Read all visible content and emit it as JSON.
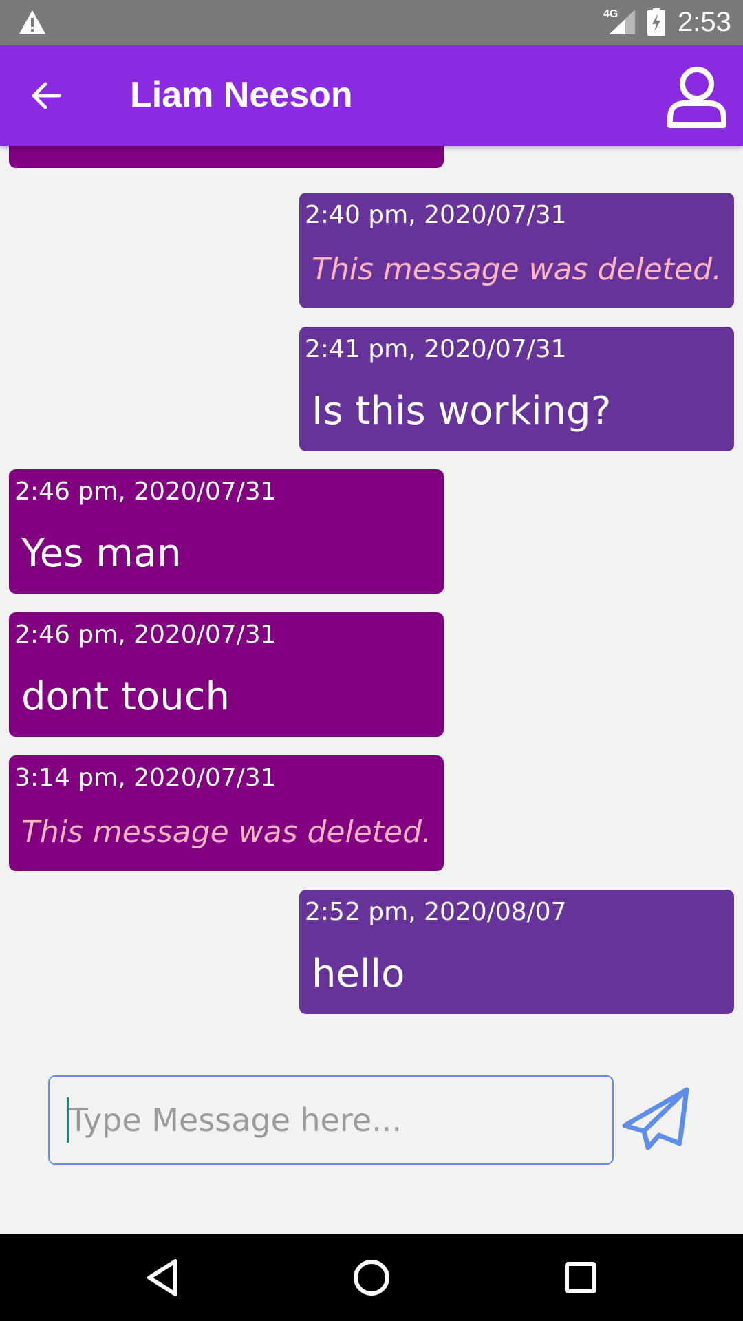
{
  "status_bar": {
    "network": "4G",
    "time": "2:53"
  },
  "header": {
    "title": "Liam Neeson"
  },
  "messages": [
    {
      "direction": "outgoing",
      "time": "2:40 pm, 2020/07/31",
      "text": "This message was deleted.",
      "deleted": true
    },
    {
      "direction": "outgoing",
      "time": "2:41 pm, 2020/07/31",
      "text": "Is this working?",
      "deleted": false
    },
    {
      "direction": "incoming",
      "time": "2:46 pm, 2020/07/31",
      "text": "Yes man",
      "deleted": false
    },
    {
      "direction": "incoming",
      "time": "2:46 pm, 2020/07/31",
      "text": "dont touch",
      "deleted": false
    },
    {
      "direction": "incoming",
      "time": "3:14 pm, 2020/07/31",
      "text": "This message was deleted.",
      "deleted": true
    },
    {
      "direction": "outgoing",
      "time": "2:52 pm, 2020/08/07",
      "text": "hello",
      "deleted": false
    }
  ],
  "composer": {
    "placeholder": "Type Message here...",
    "value": ""
  },
  "colors": {
    "app_bar": "#8a2be2",
    "incoming_bubble": "#800080",
    "outgoing_bubble": "#663399",
    "deleted_text": "#ffb6c1",
    "send_icon": "#5f8ee8"
  },
  "icons": {
    "status_warning": "warning-icon",
    "status_signal": "signal-icon",
    "status_battery": "battery-charging-icon",
    "back": "arrow-left-icon",
    "profile": "person-outline-icon",
    "send": "paper-plane-icon",
    "nav_back": "triangle-back-icon",
    "nav_home": "circle-home-icon",
    "nav_recents": "square-recents-icon"
  }
}
